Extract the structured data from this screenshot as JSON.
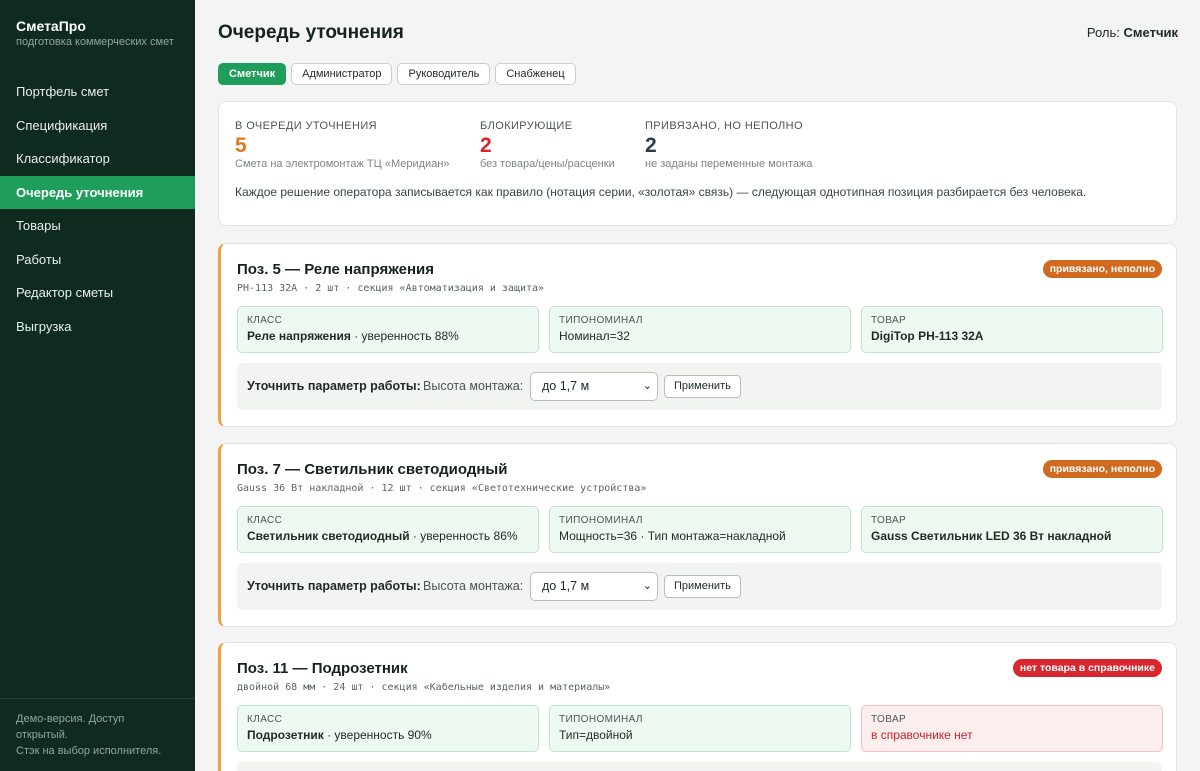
{
  "sidebar": {
    "brand_title": "СметаПро",
    "brand_sub": "подготовка коммерческих смет",
    "items": [
      {
        "label": "Портфель смет"
      },
      {
        "label": "Спецификация"
      },
      {
        "label": "Классификатор"
      },
      {
        "label": "Очередь уточнения",
        "active": true
      },
      {
        "label": "Товары"
      },
      {
        "label": "Работы"
      },
      {
        "label": "Редактор сметы"
      },
      {
        "label": "Выгрузка"
      }
    ],
    "footer_line1": "Демо-версия. Доступ",
    "footer_line2": "открытый.",
    "footer_line3": "Стэк на выбор исполнителя."
  },
  "header": {
    "title": "Очередь уточнения",
    "role_label": "Роль:",
    "role_value": "Сметчик"
  },
  "role_tabs": [
    {
      "label": "Сметчик",
      "active": true
    },
    {
      "label": "Администратор"
    },
    {
      "label": "Руководитель"
    },
    {
      "label": "Снабженец"
    }
  ],
  "summary": {
    "stats": [
      {
        "label": "В очереди уточнения",
        "value": "5",
        "note": "Смета на электромонтаж ТЦ «Меридиан»",
        "color": "#e07a20"
      },
      {
        "label": "Блокирующие",
        "value": "2",
        "note": "без товара/цены/расценки",
        "color": "#d7262e"
      },
      {
        "label": "Привязано, но неполно",
        "value": "2",
        "note": "не заданы переменные монтажа",
        "color": "#2d3a4a"
      }
    ],
    "text": "Каждое решение оператора записывается как правило (нотация серии, «золотая» связь) — следующая однотипная позиция разбирается без человека."
  },
  "cards": [
    {
      "title": "Поз. 5 — Реле напряжения",
      "sub": "РН-113 32А · 2 шт · секция «Автоматизация и защита»",
      "badge": "привязано, неполно",
      "class_label": "Класс",
      "class_name": "Реле напряжения",
      "class_conf": " · уверенность 88%",
      "type_label": "Типономинал",
      "type_value": "Номинал=32",
      "goods_label": "Товар",
      "goods_value": "DigiTop РН-113 32А",
      "refine_label": "Уточнить параметр работы:",
      "refine_param": "Высота монтажа:",
      "refine_value": "до 1,7 м",
      "apply_label": "Применить"
    },
    {
      "title": "Поз. 7 — Светильник светодиодный",
      "sub": "Gauss 36 Вт накладной · 12 шт · секция «Светотехнические устройства»",
      "badge": "привязано, неполно",
      "class_label": "Класс",
      "class_name": "Светильник светодиодный",
      "class_conf": " · уверенность 86%",
      "type_label": "Типономинал",
      "type_value": "Мощность=36 · Тип монтажа=накладной",
      "goods_label": "Товар",
      "goods_value": "Gauss Светильник LED 36 Вт накладной",
      "refine_label": "Уточнить параметр работы:",
      "refine_param": "Высота монтажа:",
      "refine_value": "до 1,7 м",
      "apply_label": "Применить"
    },
    {
      "title": "Поз. 11 — Подрозетник",
      "sub": "двойной 68 мм · 24 шт · секция «Кабельные изделия и материалы»",
      "badge": "нет товара в справочнике",
      "class_label": "Класс",
      "class_name": "Подрозетник",
      "class_conf": " · уверенность 90%",
      "type_label": "Типономинал",
      "type_value": "Тип=двойной",
      "goods_label": "Товар",
      "goods_value": "в справочнике нет"
    }
  ],
  "colors": {
    "accent": "#1e9e5a",
    "sidebar_bg": "#0f2a1f",
    "warning": "#d06a1e",
    "danger": "#d7262e"
  }
}
